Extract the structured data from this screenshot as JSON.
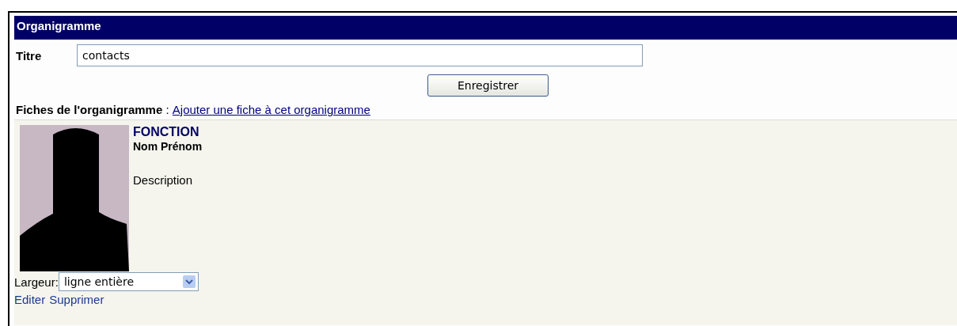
{
  "header": {
    "title": "Organigramme"
  },
  "title_field": {
    "label": "Titre",
    "value": "contacts"
  },
  "save_button": {
    "label": "Enregistrer"
  },
  "cards_heading": {
    "label": "Fiches de l'organigramme",
    "separator": " : ",
    "link": "Ajouter une fiche à cet organigramme"
  },
  "cards": [
    {
      "function": "FONCTION",
      "name": "Nom Prénom",
      "description": "Description",
      "width_label": "Largeur:",
      "width_value": "ligne entière",
      "actions": [
        "Editer",
        "Supprimer"
      ]
    }
  ]
}
